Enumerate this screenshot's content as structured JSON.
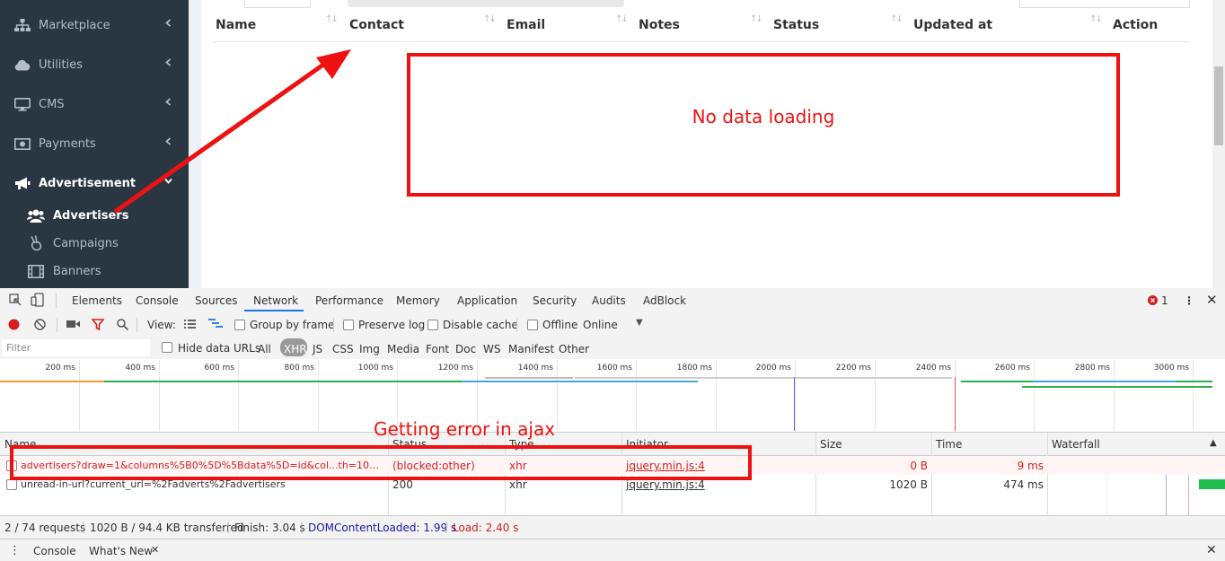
{
  "sidebar": {
    "items": [
      {
        "label": "Marketplace",
        "icon": "sitemap-icon"
      },
      {
        "label": "Utilities",
        "icon": "cloud-icon"
      },
      {
        "label": "CMS",
        "icon": "desktop-icon"
      },
      {
        "label": "Payments",
        "icon": "money-icon"
      },
      {
        "label": "Advertisement",
        "icon": "bullhorn-icon"
      }
    ],
    "subitems": [
      {
        "label": "Advertisers",
        "icon": "users-icon"
      },
      {
        "label": "Campaigns",
        "icon": "hand-icon"
      },
      {
        "label": "Banners",
        "icon": "film-icon"
      }
    ]
  },
  "table": {
    "columns": [
      "Name",
      "Contact",
      "Email",
      "Notes",
      "Status",
      "Updated at",
      "Action"
    ]
  },
  "annotations": {
    "no_data": "No data loading",
    "ajax_error": "Getting error in ajax"
  },
  "devtools": {
    "tabs": [
      "Elements",
      "Console",
      "Sources",
      "Network",
      "Performance",
      "Memory",
      "Application",
      "Security",
      "Audits",
      "AdBlock"
    ],
    "active_tab": "Network",
    "error_count": "1",
    "toolbar": {
      "view_label": "View:",
      "group_by_frame": "Group by frame",
      "preserve_log": "Preserve log",
      "disable_cache": "Disable cache",
      "offline": "Offline",
      "throttle": "Online"
    },
    "filter": {
      "placeholder": "Filter",
      "hide_data_urls": "Hide data URLs",
      "types": [
        "All",
        "XHR",
        "JS",
        "CSS",
        "Img",
        "Media",
        "Font",
        "Doc",
        "WS",
        "Manifest",
        "Other"
      ],
      "active_type": "XHR"
    },
    "overview_ticks": [
      "200 ms",
      "400 ms",
      "600 ms",
      "800 ms",
      "1000 ms",
      "1200 ms",
      "1400 ms",
      "1600 ms",
      "1800 ms",
      "2000 ms",
      "2200 ms",
      "2400 ms",
      "2600 ms",
      "2800 ms",
      "3000 ms"
    ],
    "columns": [
      "Name",
      "Status",
      "Type",
      "Initiator",
      "Size",
      "Time",
      "Waterfall"
    ],
    "requests": [
      {
        "name": "advertisers?draw=1&columns%5B0%5D%5Bdata%5D=id&col...th=10&sea...",
        "status": "(blocked:other)",
        "type": "xhr",
        "initiator": "jquery.min.js:4",
        "size": "0 B",
        "time": "9 ms"
      },
      {
        "name": "unread-in-url?current_url=%2Fadverts%2Fadvertisers",
        "status": "200",
        "type": "xhr",
        "initiator": "jquery.min.js:4",
        "size": "1020 B",
        "time": "474 ms"
      }
    ],
    "status": {
      "requests": "2 / 74 requests",
      "transferred": "1020 B / 94.4 KB transferred",
      "finish": "Finish: 3.04 s",
      "dom_loaded": "DOMContentLoaded: 1.99 s",
      "load": "Load: 2.40 s"
    },
    "drawer_tabs": [
      "Console",
      "What's New"
    ],
    "colors": {
      "error": "#d61e1e",
      "dom_loaded": "#1a1aa6",
      "load": "#d61e1e",
      "accent": "#1a73e8"
    }
  }
}
